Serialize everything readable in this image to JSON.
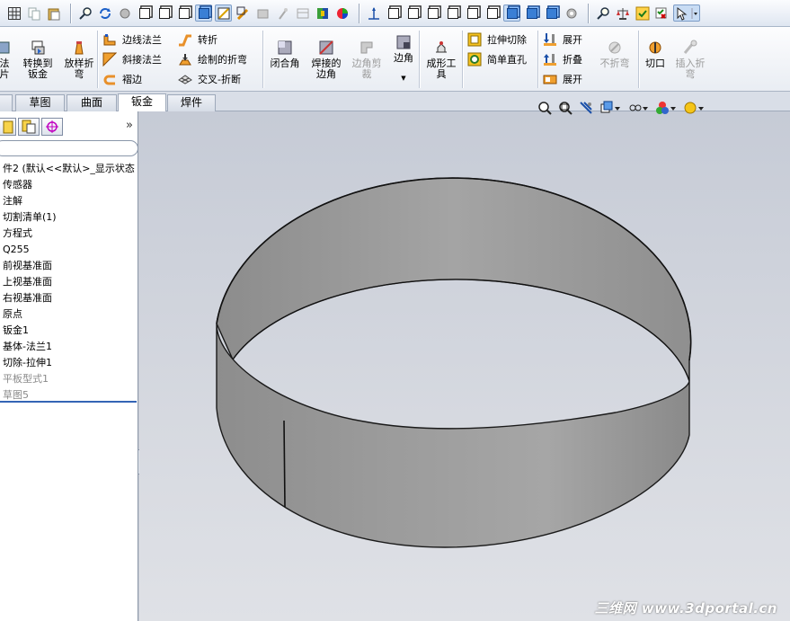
{
  "colors": {
    "accent_blue": "#3a7fd5",
    "toolbar_bg": "#e6ebf3",
    "viewport_bg": "#cfd3dc",
    "part_fill": "#9a9a9a",
    "rollback_bar": "#3464b5"
  },
  "toolbar_top": {
    "icons": [
      "grid-icon",
      "copy-icon",
      "paste-icon",
      "zoom-fit-icon",
      "rotate-icon",
      "model-icon",
      "cube-wire-icon",
      "cube-hidden-icon",
      "cube-shaded-icon",
      "cube-edges-icon",
      "section-view-icon",
      "curvature-icon",
      "display-icon",
      "appearance-icon",
      "rebuild-icon",
      "color-wheel-icon",
      "triad-icon",
      "view-front-icon",
      "view-back-icon",
      "view-left-icon",
      "view-right-icon",
      "view-top-icon",
      "view-iso-icon",
      "view-trimetric-icon",
      "view-dimetric-icon",
      "settings-icon",
      "measure-icon",
      "mass-props-icon",
      "check-icon",
      "eval-icon",
      "select-icon"
    ]
  },
  "ribbon": {
    "big_buttons": [
      {
        "name": "flange-partial",
        "label": "法\n片"
      },
      {
        "name": "convert-to-sheet",
        "label": "转换到\n钣金"
      },
      {
        "name": "lofted-bend",
        "label": "放样折\n弯"
      },
      {
        "name": "closed-corner",
        "label": "闭合角"
      },
      {
        "name": "welded-corner",
        "label": "焊接的\n边角"
      },
      {
        "name": "corner-trim",
        "label": "边角剪\n裁"
      },
      {
        "name": "corner",
        "label": "边角"
      },
      {
        "name": "forming-tool",
        "label": "成形工\n具"
      },
      {
        "name": "cut",
        "label": "切口"
      },
      {
        "name": "insert-bends",
        "label": "插入折\n弯"
      }
    ],
    "small_buttons": [
      {
        "name": "edge-flange",
        "label": "边线法兰"
      },
      {
        "name": "miter-flange",
        "label": "斜接法兰"
      },
      {
        "name": "hem",
        "label": "褶边"
      },
      {
        "name": "jog",
        "label": "转折"
      },
      {
        "name": "sketched-bend",
        "label": "绘制的折弯"
      },
      {
        "name": "cross-break",
        "label": "交叉-折断"
      },
      {
        "name": "extruded-cut",
        "label": "拉伸切除"
      },
      {
        "name": "simple-hole",
        "label": "简单直孔"
      },
      {
        "name": "unfold",
        "label": "展开"
      },
      {
        "name": "fold",
        "label": "折叠"
      },
      {
        "name": "flatten",
        "label": "展开"
      },
      {
        "name": "no-bends",
        "label": "不折弯"
      }
    ]
  },
  "tabs": [
    {
      "name": "tab-partial",
      "label": ""
    },
    {
      "name": "tab-sketch",
      "label": "草图"
    },
    {
      "name": "tab-surface",
      "label": "曲面"
    },
    {
      "name": "tab-sheet-metal",
      "label": "钣金"
    },
    {
      "name": "tab-weldments",
      "label": "焊件"
    }
  ],
  "panel": {
    "expand_glyph": "»",
    "tree": [
      {
        "label": "件2  (默认<<默认>_显示状态",
        "dim": false
      },
      {
        "label": "传感器",
        "dim": false
      },
      {
        "label": "注解",
        "dim": false
      },
      {
        "label": "切割清单(1)",
        "dim": false
      },
      {
        "label": "方程式",
        "dim": false
      },
      {
        "label": "Q255",
        "dim": false
      },
      {
        "label": "前视基准面",
        "dim": false
      },
      {
        "label": "上视基准面",
        "dim": false
      },
      {
        "label": "右视基准面",
        "dim": false
      },
      {
        "label": "原点",
        "dim": false
      },
      {
        "label": "钣金1",
        "dim": false
      },
      {
        "label": "基体-法兰1",
        "dim": false
      },
      {
        "label": "切除-拉伸1",
        "dim": false
      },
      {
        "label": "平板型式1",
        "dim": true
      },
      {
        "label": "草图5",
        "dim": true
      }
    ]
  },
  "watermark": "三维网 www.3dportal.cn"
}
